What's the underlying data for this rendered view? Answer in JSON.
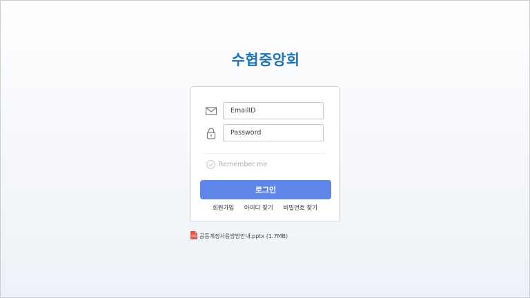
{
  "brand": {
    "title": "수협중앙회"
  },
  "login": {
    "email_placeholder": "EmailID",
    "password_placeholder": "Password",
    "remember_label": "Remember me",
    "login_button": "로그인",
    "links": [
      "회원가입",
      "아이디 찾기",
      "비밀번호 찾기"
    ]
  },
  "attachment": {
    "name": "공동계정사용방법안내.pptx (1.7MB)"
  },
  "colors": {
    "brand": "#1b74b8",
    "button": "#5f86ea",
    "icon": "#7b7f8c"
  },
  "icons": {
    "email": "envelope-icon",
    "password": "lock-icon",
    "remember": "check-circle-icon",
    "file": "pptx-file-icon"
  }
}
